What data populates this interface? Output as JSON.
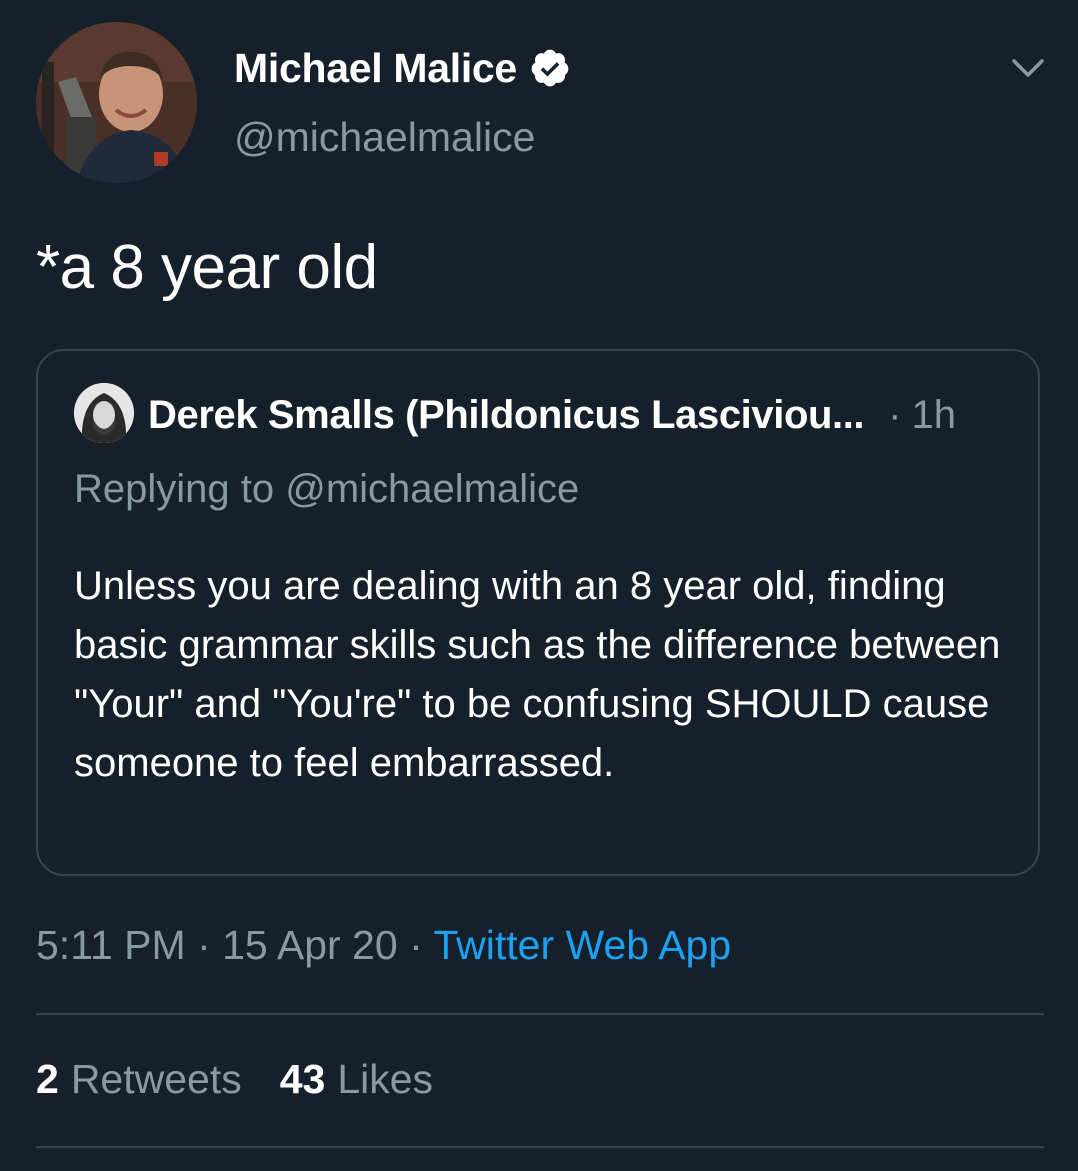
{
  "tweet": {
    "author": {
      "display_name": "Michael Malice",
      "handle": "@michaelmalice",
      "verified": true
    },
    "text": "*a 8 year old",
    "quote": {
      "author_name": "Derek Smalls (Phildonicus Lasciviou...",
      "separator": "·",
      "time": "1h",
      "replying_to": "Replying to @michaelmalice",
      "body": "Unless you are dealing with an 8 year old, finding basic grammar skills such as the difference between \"Your\" and \"You're\" to be confusing SHOULD cause someone to feel embarrassed."
    },
    "meta": {
      "time": "5:11 PM",
      "sep1": "·",
      "date": "15 Apr 20",
      "sep2": "·",
      "source": "Twitter Web App"
    },
    "stats": {
      "retweets_count": "2",
      "retweets_label": "Retweets",
      "likes_count": "43",
      "likes_label": "Likes"
    }
  },
  "colors": {
    "background": "#15202b",
    "secondary_text": "#8899a6",
    "link": "#1da1f2",
    "border": "#38444d"
  },
  "icons": {
    "verified": "verified-badge-icon",
    "menu": "chevron-down-icon"
  }
}
